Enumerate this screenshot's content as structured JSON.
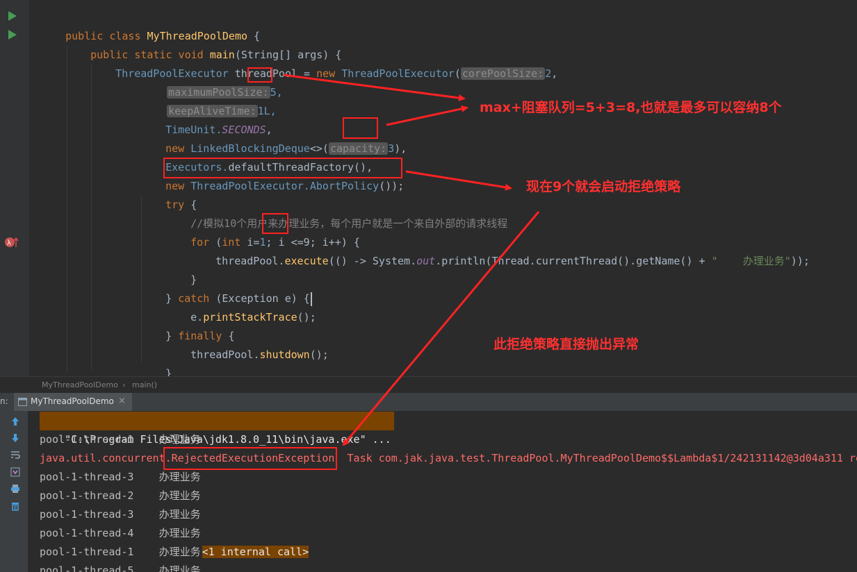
{
  "editor": {
    "lines": {
      "l1": {
        "kw": "public class ",
        "name": "MyThreadPoolDemo",
        "rest": " {"
      },
      "l2": {
        "kw": "public static void ",
        "name": "main",
        "rest": "(String[] args) {"
      },
      "l3": {
        "type": "ThreadPoolExecutor",
        "var": " threadPool = ",
        "kw": "new ",
        "cls": "ThreadPoolExecutor",
        "open": "(",
        "hint": "corePoolSize:",
        "val": "2",
        ",": ","
      },
      "l4": {
        "hint": "maximumPoolSize:",
        "val": "5,"
      },
      "l5": {
        "hint": "keepAliveTime:",
        "val": "1L,"
      },
      "l6": {
        "cls": "TimeUnit.",
        "field": "SECONDS",
        "rest": ","
      },
      "l7": {
        "kw": "new ",
        "cls": "LinkedBlockingDeque",
        "rest": "<>(",
        "hint": "capacity:",
        "val": "3",
        "end": "),"
      },
      "l8": {
        "cls": "Executors.",
        "rest": "defaultThreadFactory(),"
      },
      "l9": {
        "kw": "new ",
        "cls": "ThreadPoolExecutor.AbortPolicy",
        "rest": "());"
      },
      "l10": {
        "kw": "try",
        "rest": " {"
      },
      "l11": {
        "comment": "//模拟10个用户来办理业务，每个用户就是一个来自外部的请求线程"
      },
      "l12": {
        "kw": "for ",
        "a": "(",
        "kw2": "int ",
        "b": "i=",
        "n1": "1",
        "c": "; i ",
        "cond": "<=9",
        "d": "; i++) {"
      },
      "l13": {
        "a": "threadPool.",
        "fn": "execute",
        "b": "(() -> System.",
        "field": "out",
        "c": ".println(Thread.currentThread().getName() + ",
        "str": "\"    办理业务\"",
        "d": "));"
      },
      "l14": {
        "rest": "}"
      },
      "l15": {
        "a": "} ",
        "kw": "catch ",
        "b": "(Exception e) {"
      },
      "l16": {
        "a": "e.",
        "fn": "printStackTrace",
        "b": "();"
      },
      "l17": {
        "a": "} ",
        "kw": "finally ",
        "b": "{"
      },
      "l18": {
        "a": "threadPool.",
        "fn": "shutdown",
        "b": "();"
      },
      "l19": {
        "rest": "}"
      },
      "l20": {
        "rest": "}"
      }
    }
  },
  "annotations": {
    "max_note": "max+阻塞队列=5+3=8,也就是最多可以容纳8个",
    "nine_note": "现在9个就会启动拒绝策略",
    "throw_note": "此拒绝策略直接抛出异常"
  },
  "breadcrumb": {
    "class": "MyThreadPoolDemo",
    "sep": "›",
    "method": "main()"
  },
  "run_tab": {
    "prefix": "n:",
    "label": "MyThreadPoolDemo",
    "close": "×"
  },
  "console": {
    "cmd": "\"C:\\Program Files\\Java\\jdk1.8.0_11\\bin\\java.exe\" ...",
    "lines": [
      {
        "text": "pool-1-thread-1    办理业务"
      },
      {
        "text": "java.util.concurrent.RejectedExecutionException  Task com.jak.java.test.ThreadPool.MyThreadPoolDemo$$Lambda$1/242131142@3d04a311 re"
      },
      {
        "text": "pool-1-thread-3    办理业务"
      },
      {
        "text": "pool-1-thread-2    办理业务"
      },
      {
        "text": "pool-1-thread-3    办理业务"
      },
      {
        "text": "pool-1-thread-4    办理业务"
      },
      {
        "text": "pool-1-thread-1    办理业务"
      },
      {
        "text": "pool-1-thread-5    办理业务"
      }
    ],
    "internal_call": "<1 internal call>"
  },
  "colors": {
    "accent_red": "#ff2222",
    "run_green": "#499c54",
    "bg": "#2b2b2b"
  }
}
